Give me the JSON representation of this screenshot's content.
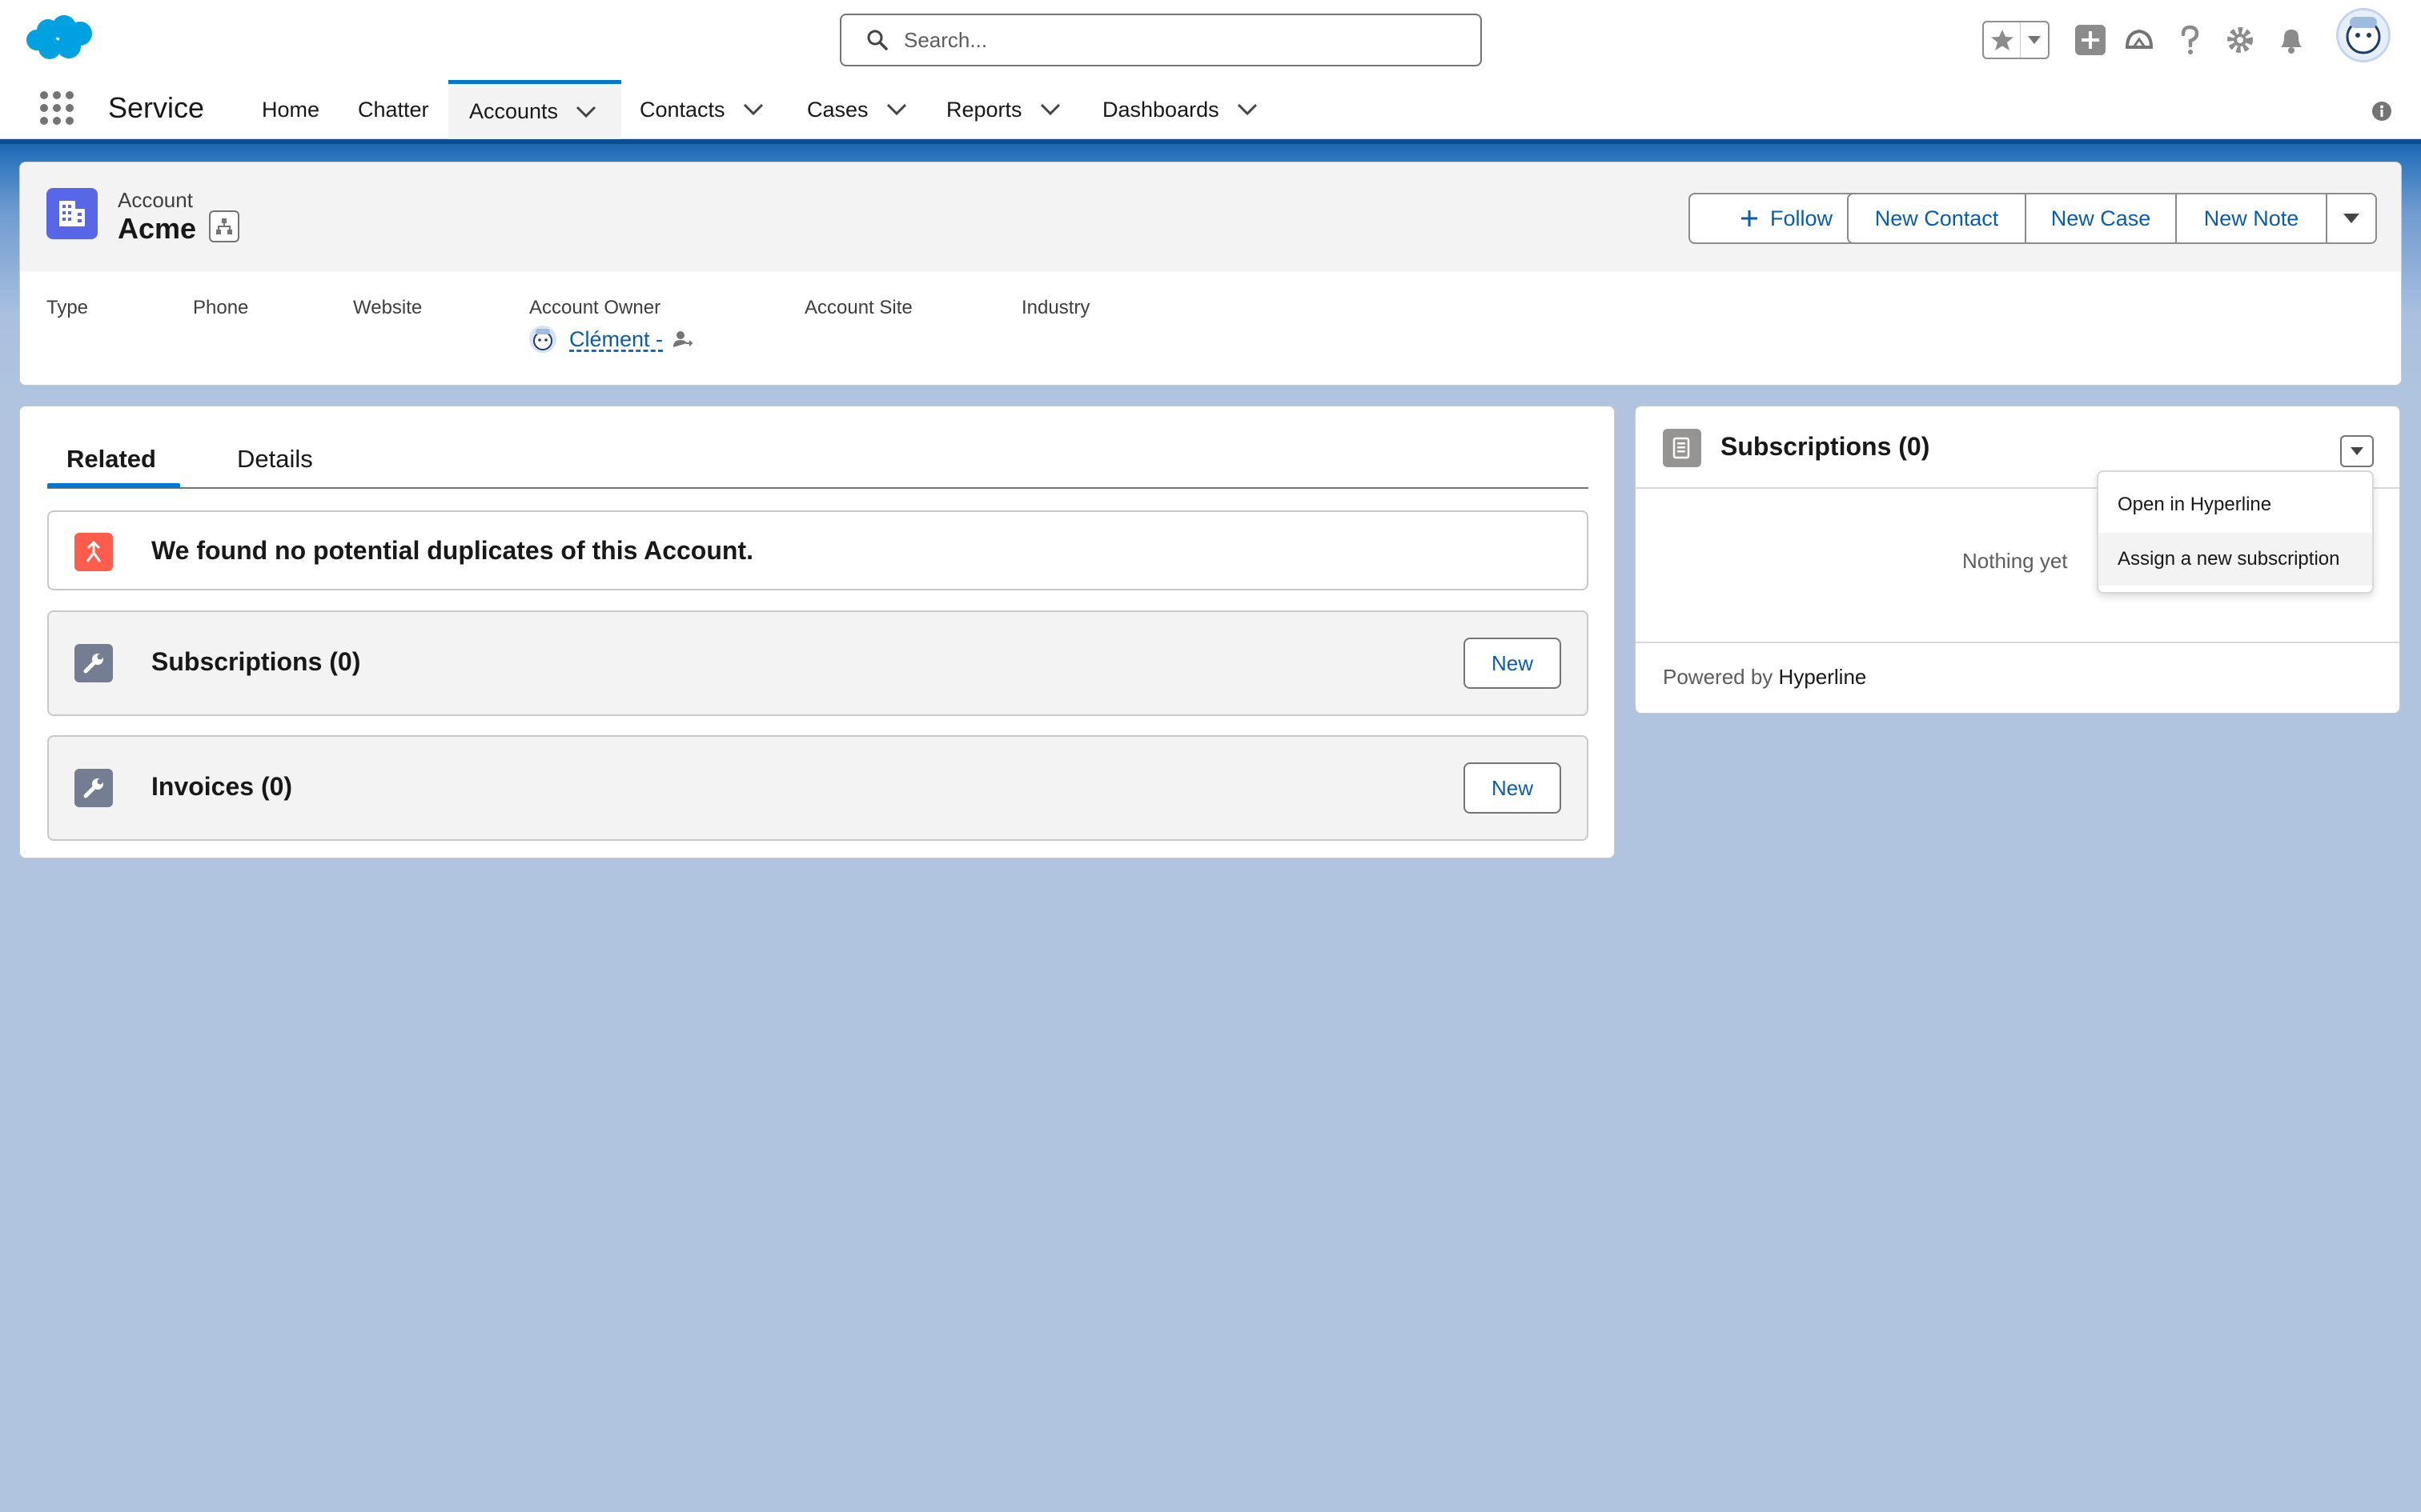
{
  "header": {
    "search_placeholder": "Search...",
    "icons": [
      "salesforce-logo",
      "search-icon",
      "favorites-star-icon",
      "global-actions-plus-icon",
      "trailhead-icon",
      "help-icon",
      "setup-gear-icon",
      "notifications-bell-icon",
      "user-avatar"
    ]
  },
  "nav": {
    "app_name": "Service",
    "items": [
      {
        "label": "Home",
        "has_menu": false
      },
      {
        "label": "Chatter",
        "has_menu": false
      },
      {
        "label": "Accounts",
        "has_menu": true,
        "active": true
      },
      {
        "label": "Contacts",
        "has_menu": true
      },
      {
        "label": "Cases",
        "has_menu": true
      },
      {
        "label": "Reports",
        "has_menu": true
      },
      {
        "label": "Dashboards",
        "has_menu": true
      }
    ]
  },
  "record": {
    "object_label": "Account",
    "name": "Acme",
    "actions": {
      "follow": "Follow",
      "new_contact": "New Contact",
      "new_case": "New Case",
      "new_note": "New Note"
    },
    "fields": {
      "type": "Type",
      "phone": "Phone",
      "website": "Website",
      "account_owner": "Account Owner",
      "account_site": "Account Site",
      "industry": "Industry"
    },
    "owner_name": "Clément -"
  },
  "main": {
    "tabs": [
      "Related",
      "Details"
    ],
    "duplicates_message": "We found no potential duplicates of this Account.",
    "related_lists": [
      {
        "title": "Subscriptions (0)",
        "button": "New"
      },
      {
        "title": "Invoices (0)",
        "button": "New"
      }
    ]
  },
  "side": {
    "title": "Subscriptions (0)",
    "empty_text": "Nothing yet",
    "powered_prefix": "Powered by",
    "powered_brand": "Hyperline",
    "menu": [
      "Open in Hyperline",
      "Assign a new subscription"
    ]
  },
  "colors": {
    "brand_blue": "#0176d3",
    "link_blue": "#0b5cab",
    "account_icon": "#5867e8",
    "duplicate_icon": "#fe5c4c",
    "background": "#b0c4df"
  }
}
